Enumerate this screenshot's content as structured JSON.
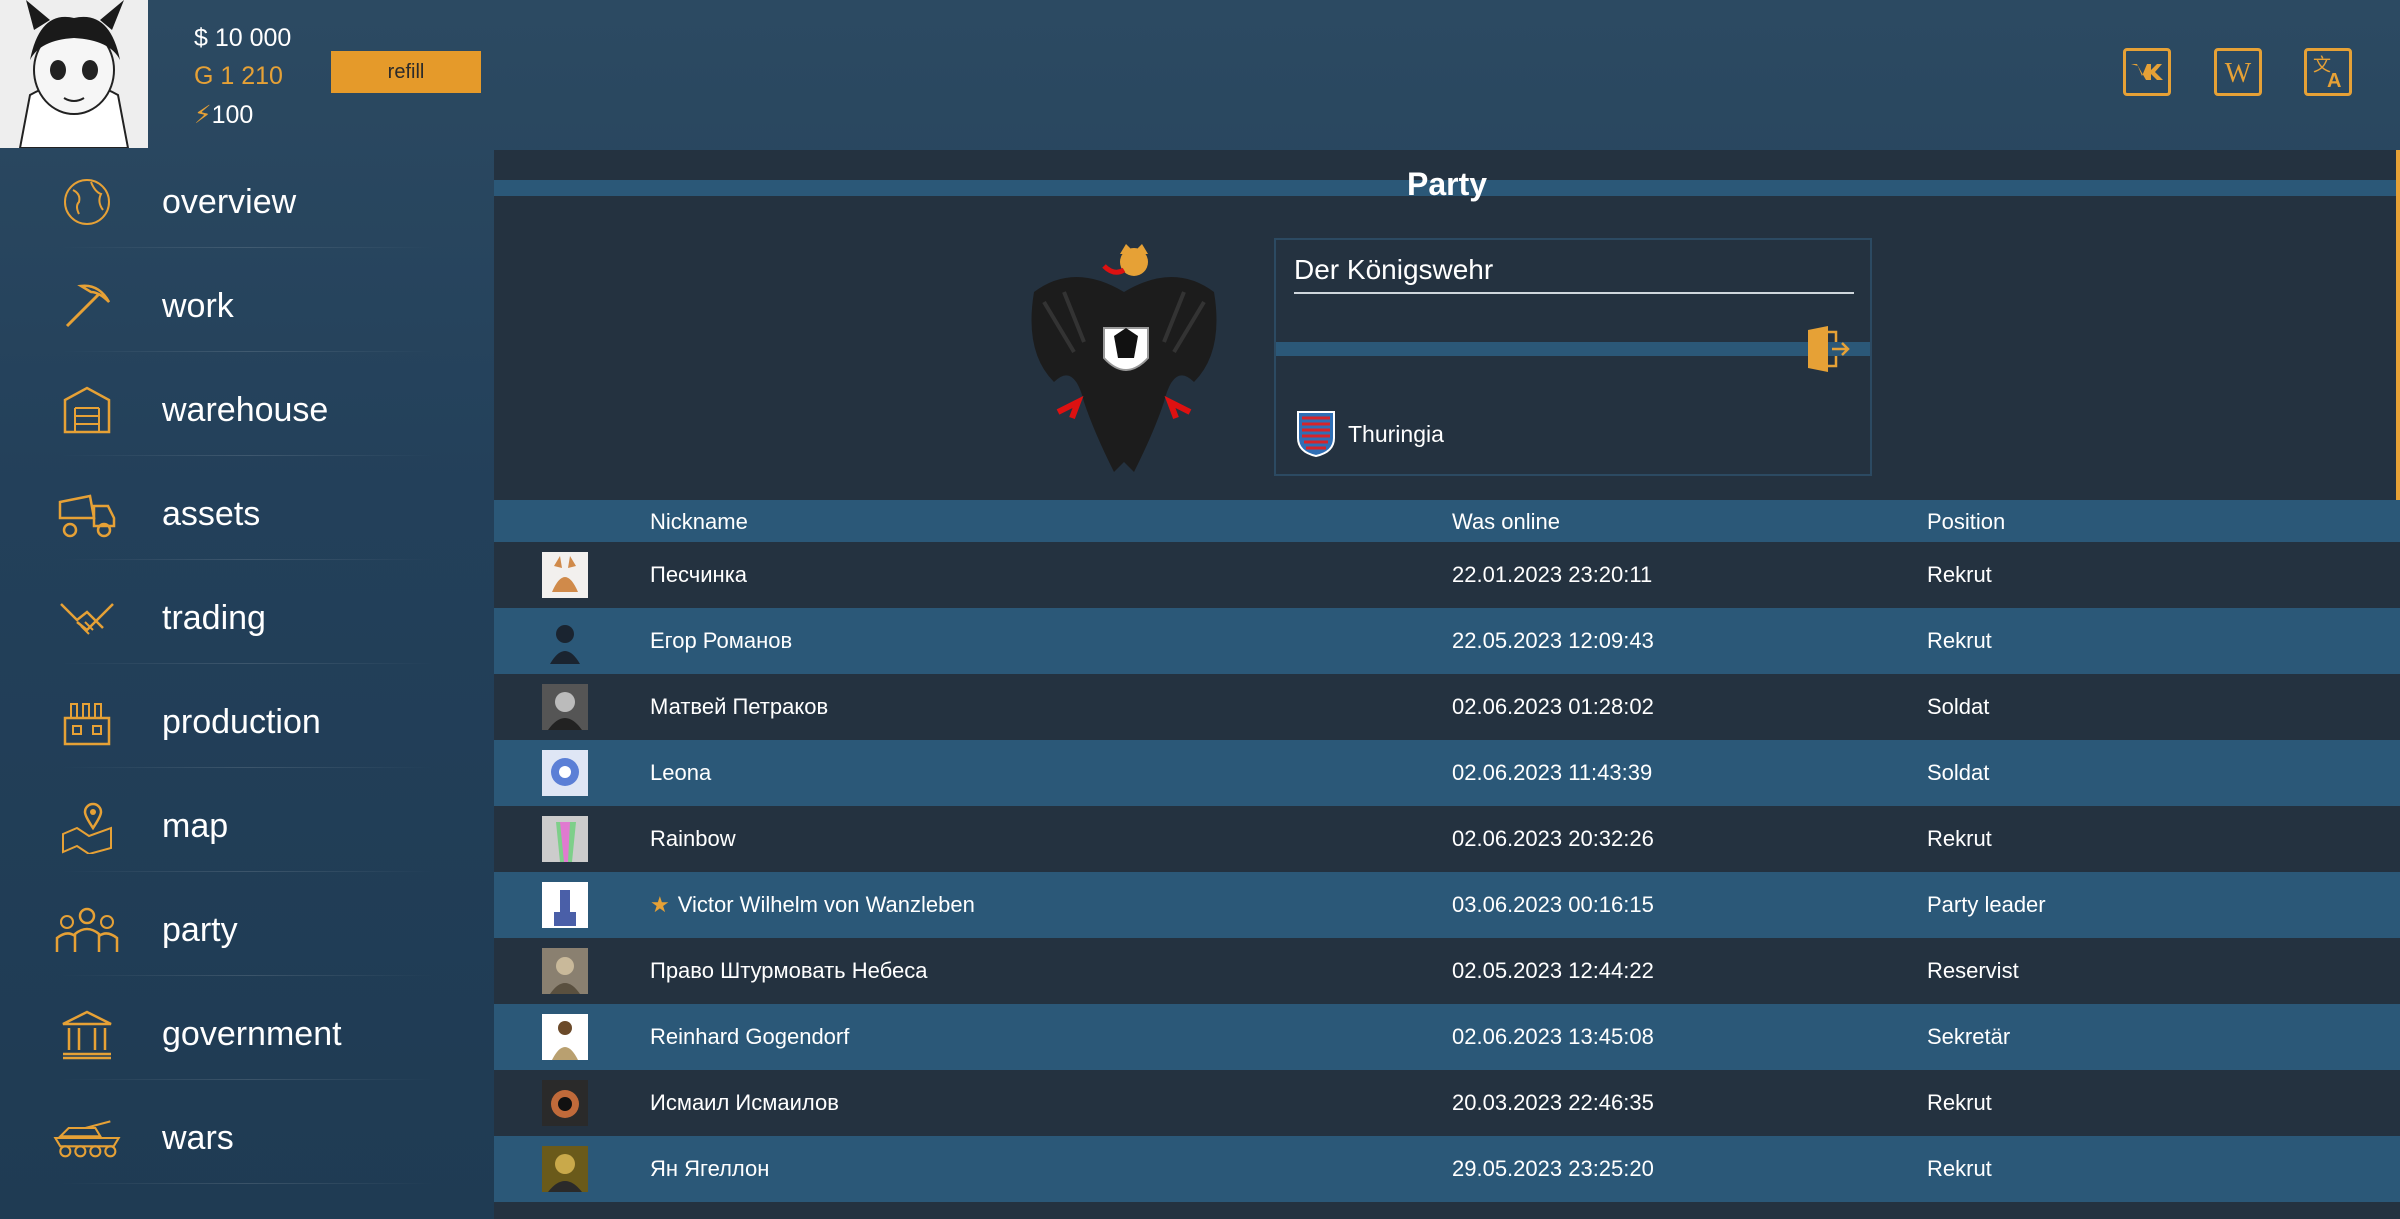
{
  "header": {
    "money": "$ 10 000",
    "gold": "G 1 210",
    "energy": "100",
    "refill_label": "refill",
    "social_icons": [
      "vk-icon",
      "wiki-icon",
      "translate-icon"
    ]
  },
  "sidebar": {
    "items": [
      {
        "label": "overview",
        "icon": "globe-icon"
      },
      {
        "label": "work",
        "icon": "pickaxe-icon"
      },
      {
        "label": "warehouse",
        "icon": "warehouse-icon"
      },
      {
        "label": "assets",
        "icon": "truck-icon"
      },
      {
        "label": "trading",
        "icon": "handshake-icon"
      },
      {
        "label": "production",
        "icon": "factory-icon"
      },
      {
        "label": "map",
        "icon": "map-pin-icon"
      },
      {
        "label": "party",
        "icon": "people-icon"
      },
      {
        "label": "government",
        "icon": "government-building-icon"
      },
      {
        "label": "wars",
        "icon": "tank-icon"
      }
    ]
  },
  "party": {
    "title": "Party",
    "name": "Der Königswehr",
    "region": "Thuringia"
  },
  "table": {
    "headers": [
      "Nickname",
      "Was online",
      "Position"
    ],
    "rows": [
      {
        "nickname": "Песчинка",
        "online": "22.01.2023 23:20:11",
        "position": "Rekrut"
      },
      {
        "nickname": "Егор Романов",
        "online": "22.05.2023 12:09:43",
        "position": "Rekrut"
      },
      {
        "nickname": "Матвей Петраков",
        "online": "02.06.2023 01:28:02",
        "position": "Soldat"
      },
      {
        "nickname": "Leona",
        "online": "02.06.2023 11:43:39",
        "position": "Soldat"
      },
      {
        "nickname": "Rainbow",
        "online": "02.06.2023 20:32:26",
        "position": "Rekrut"
      },
      {
        "nickname": "Victor Wilhelm von Wanzleben",
        "online": "03.06.2023 00:16:15",
        "position": "Party leader",
        "leader": true
      },
      {
        "nickname": "Право Штурмовать Небеса",
        "online": "02.05.2023 12:44:22",
        "position": "Reservist"
      },
      {
        "nickname": "Reinhard Gogendorf",
        "online": "02.06.2023 13:45:08",
        "position": "Sekretär"
      },
      {
        "nickname": "Исмаил Исмаилов",
        "online": "20.03.2023 22:46:35",
        "position": "Rekrut"
      },
      {
        "nickname": "Ян Ягеллон",
        "online": "29.05.2023 23:25:20",
        "position": "Rekrut"
      }
    ]
  },
  "colors": {
    "accent": "#e6a136",
    "panel": "#243240",
    "row_alt": "#2b5878"
  }
}
